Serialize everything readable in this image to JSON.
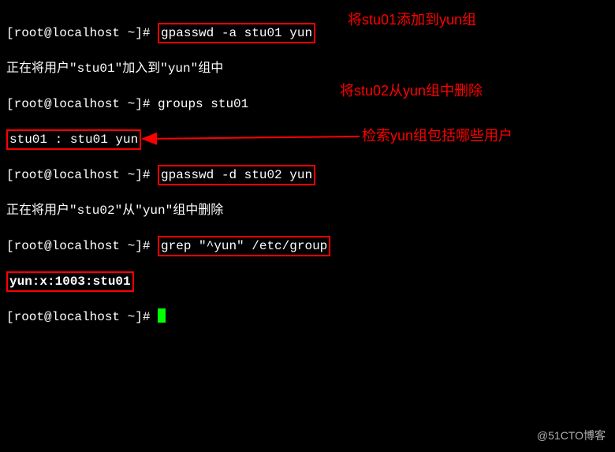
{
  "terminal": {
    "prompt": "[root@localhost ~]# ",
    "lines": {
      "cmd1": "gpasswd -a stu01 yun",
      "out1": "正在将用户\"stu01\"加入到\"yun\"组中",
      "cmd2": "groups stu01",
      "out2": "stu01 : stu01 yun",
      "cmd3": "gpasswd -d stu02 yun",
      "out3": "正在将用户\"stu02\"从\"yun\"组中删除",
      "cmd4": "grep \"^yun\" /etc/group",
      "out4": "yun:x:1003:stu01",
      "cmd5": ""
    }
  },
  "annotations": {
    "a1": "将stu01添加到yun组",
    "a2": "将stu02从yun组中删除",
    "a3": "检索yun组包括哪些用户"
  },
  "watermark": "@51CTO博客"
}
